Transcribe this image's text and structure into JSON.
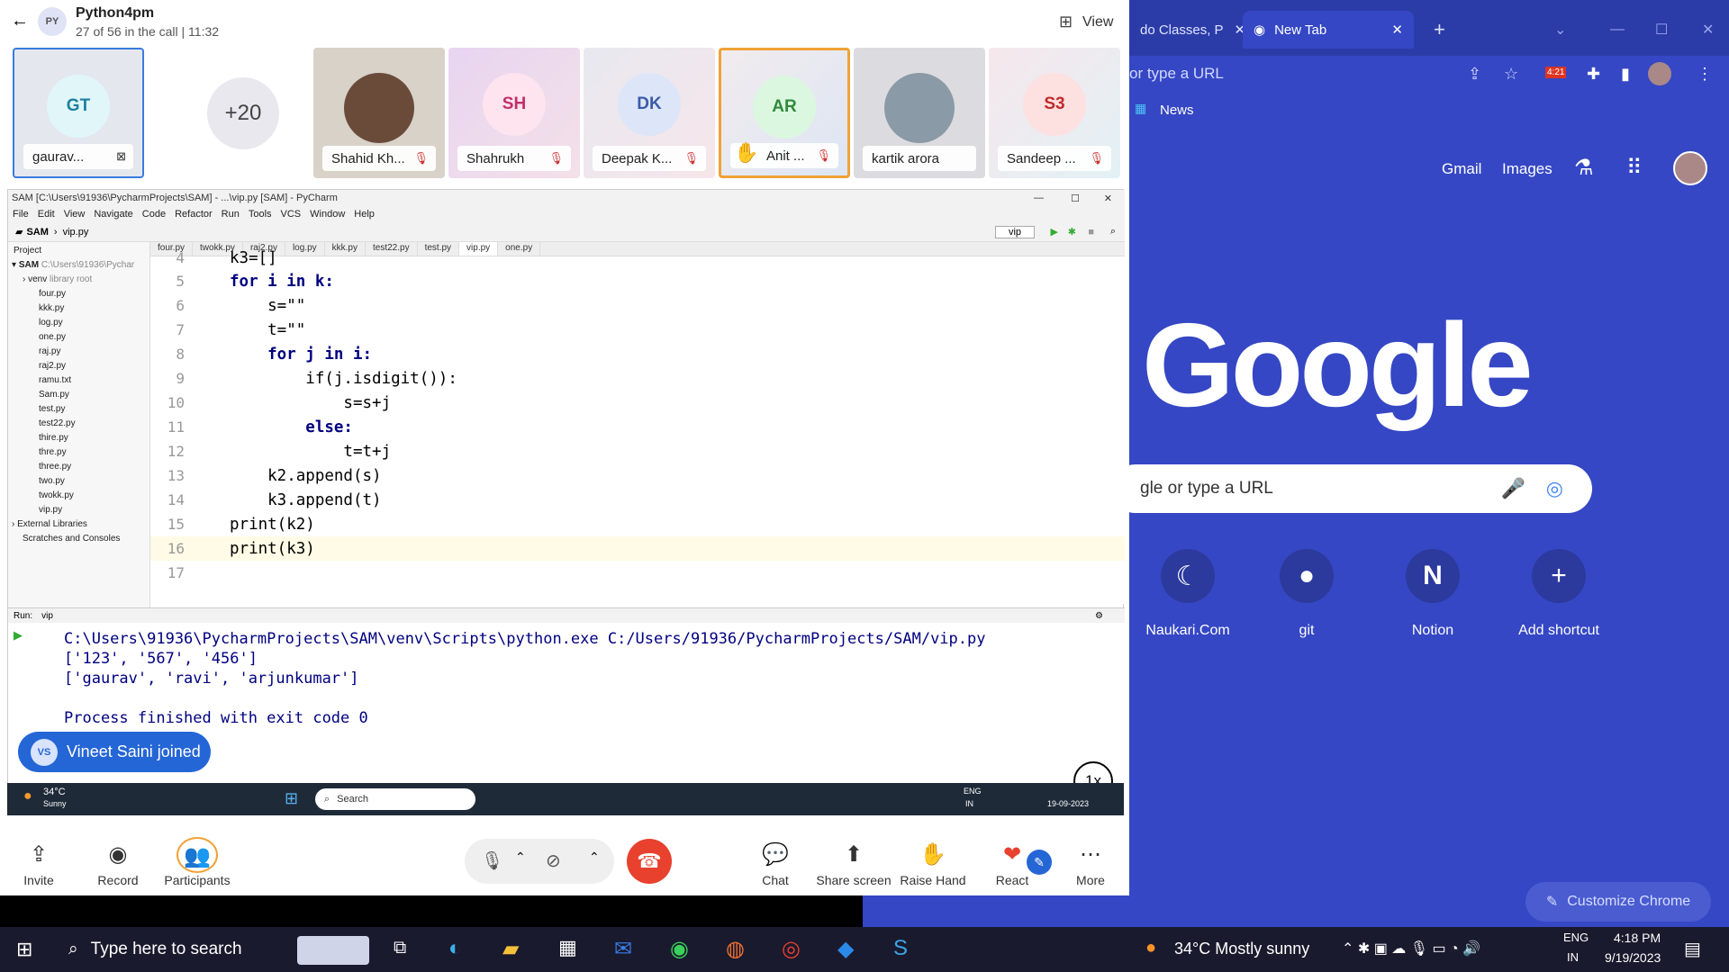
{
  "call": {
    "back": "←",
    "team_initials": "PY",
    "title": "Python4pm",
    "subtitle": "27 of 56 in the call | 11:32",
    "view_label": "View",
    "overflow_count": "+20",
    "participants": [
      {
        "initials": "GT",
        "name": "gaurav..."
      },
      {
        "initials": "",
        "name": "Shahid Kh..."
      },
      {
        "initials": "SH",
        "name": "Shahrukh"
      },
      {
        "initials": "DK",
        "name": "Deepak K..."
      },
      {
        "initials": "AR",
        "name": "Anit ..."
      },
      {
        "initials": "",
        "name": "kartik arora"
      },
      {
        "initials": "S3",
        "name": "Sandeep ..."
      }
    ],
    "controls": {
      "invite": "Invite",
      "record": "Record",
      "participants": "Participants",
      "chat": "Chat",
      "share": "Share screen",
      "raise": "Raise Hand",
      "react": "React",
      "more": "More"
    },
    "toast_initials": "VS",
    "toast_text": "Vineet Saini joined",
    "speed": "1x"
  },
  "pycharm": {
    "title": "SAM [C:\\Users\\91936\\PycharmProjects\\SAM] - ...\\vip.py [SAM] - PyCharm",
    "menu": [
      "File",
      "Edit",
      "View",
      "Navigate",
      "Code",
      "Refactor",
      "Run",
      "Tools",
      "VCS",
      "Window",
      "Help"
    ],
    "breadcrumb_project": "SAM",
    "breadcrumb_file": "vip.py",
    "run_config": "vip",
    "project_label": "Project",
    "project_root": "SAM",
    "project_root_path": "C:\\Users\\91936\\Pychar",
    "venv": "venv",
    "venv_note": "library root",
    "files": [
      "four.py",
      "kkk.py",
      "log.py",
      "one.py",
      "raj.py",
      "raj2.py",
      "ramu.txt",
      "Sam.py",
      "test.py",
      "test22.py",
      "thire.py",
      "thre.py",
      "three.py",
      "two.py",
      "twokk.py",
      "vip.py"
    ],
    "external_libraries": "External Libraries",
    "scratches": "Scratches and Consoles",
    "tabs": [
      "four.py",
      "twokk.py",
      "raj2.py",
      "log.py",
      "kkk.py",
      "test22.py",
      "test.py",
      "vip.py",
      "one.py"
    ],
    "code_lines": [
      {
        "n": "4",
        "text": "k3=[]"
      },
      {
        "n": "5",
        "text": "for i in k:"
      },
      {
        "n": "6",
        "text": "    s=\"\""
      },
      {
        "n": "7",
        "text": "    t=\"\""
      },
      {
        "n": "8",
        "text": "    for j in i:"
      },
      {
        "n": "9",
        "text": "        if(j.isdigit()):"
      },
      {
        "n": "10",
        "text": "            s=s+j"
      },
      {
        "n": "11",
        "text": "        else:"
      },
      {
        "n": "12",
        "text": "            t=t+j"
      },
      {
        "n": "13",
        "text": "    k2.append(s)"
      },
      {
        "n": "14",
        "text": "    k3.append(t)"
      },
      {
        "n": "15",
        "text": "print(k2)"
      },
      {
        "n": "16",
        "text": "print(k3)"
      },
      {
        "n": "17",
        "text": ""
      }
    ],
    "run_label": "Run:",
    "run_tab": "vip",
    "output": [
      "C:\\Users\\91936\\PycharmProjects\\SAM\\venv\\Scripts\\python.exe C:/Users/91936/PycharmProjects/SAM/vip.py",
      "['123', '567', '456']",
      "['gaurav', 'ravi', 'arjunkumar']",
      "",
      "Process finished with exit code 0"
    ]
  },
  "inner_taskbar": {
    "temp": "34°C",
    "weather": "Sunny",
    "search": "Search",
    "lang": "ENG",
    "region": "IN",
    "date": "19-09-2023"
  },
  "chrome": {
    "tab_inactive": "do Classes, P",
    "tab_active": "New Tab",
    "address_placeholder": "or type a URL",
    "bookmark": "News",
    "top_links": [
      "Gmail",
      "Images"
    ],
    "logo": "Google",
    "search_placeholder": "gle or type a URL",
    "shortcuts": [
      "Naukari.Com",
      "git",
      "Notion",
      "Add shortcut"
    ],
    "customize": "Customize Chrome",
    "badge": "4:21"
  },
  "taskbar": {
    "search": "Type here to search",
    "weather": "34°C  Mostly sunny",
    "lang": "ENG",
    "region": "IN",
    "time": "4:18 PM",
    "date": "9/19/2023"
  }
}
